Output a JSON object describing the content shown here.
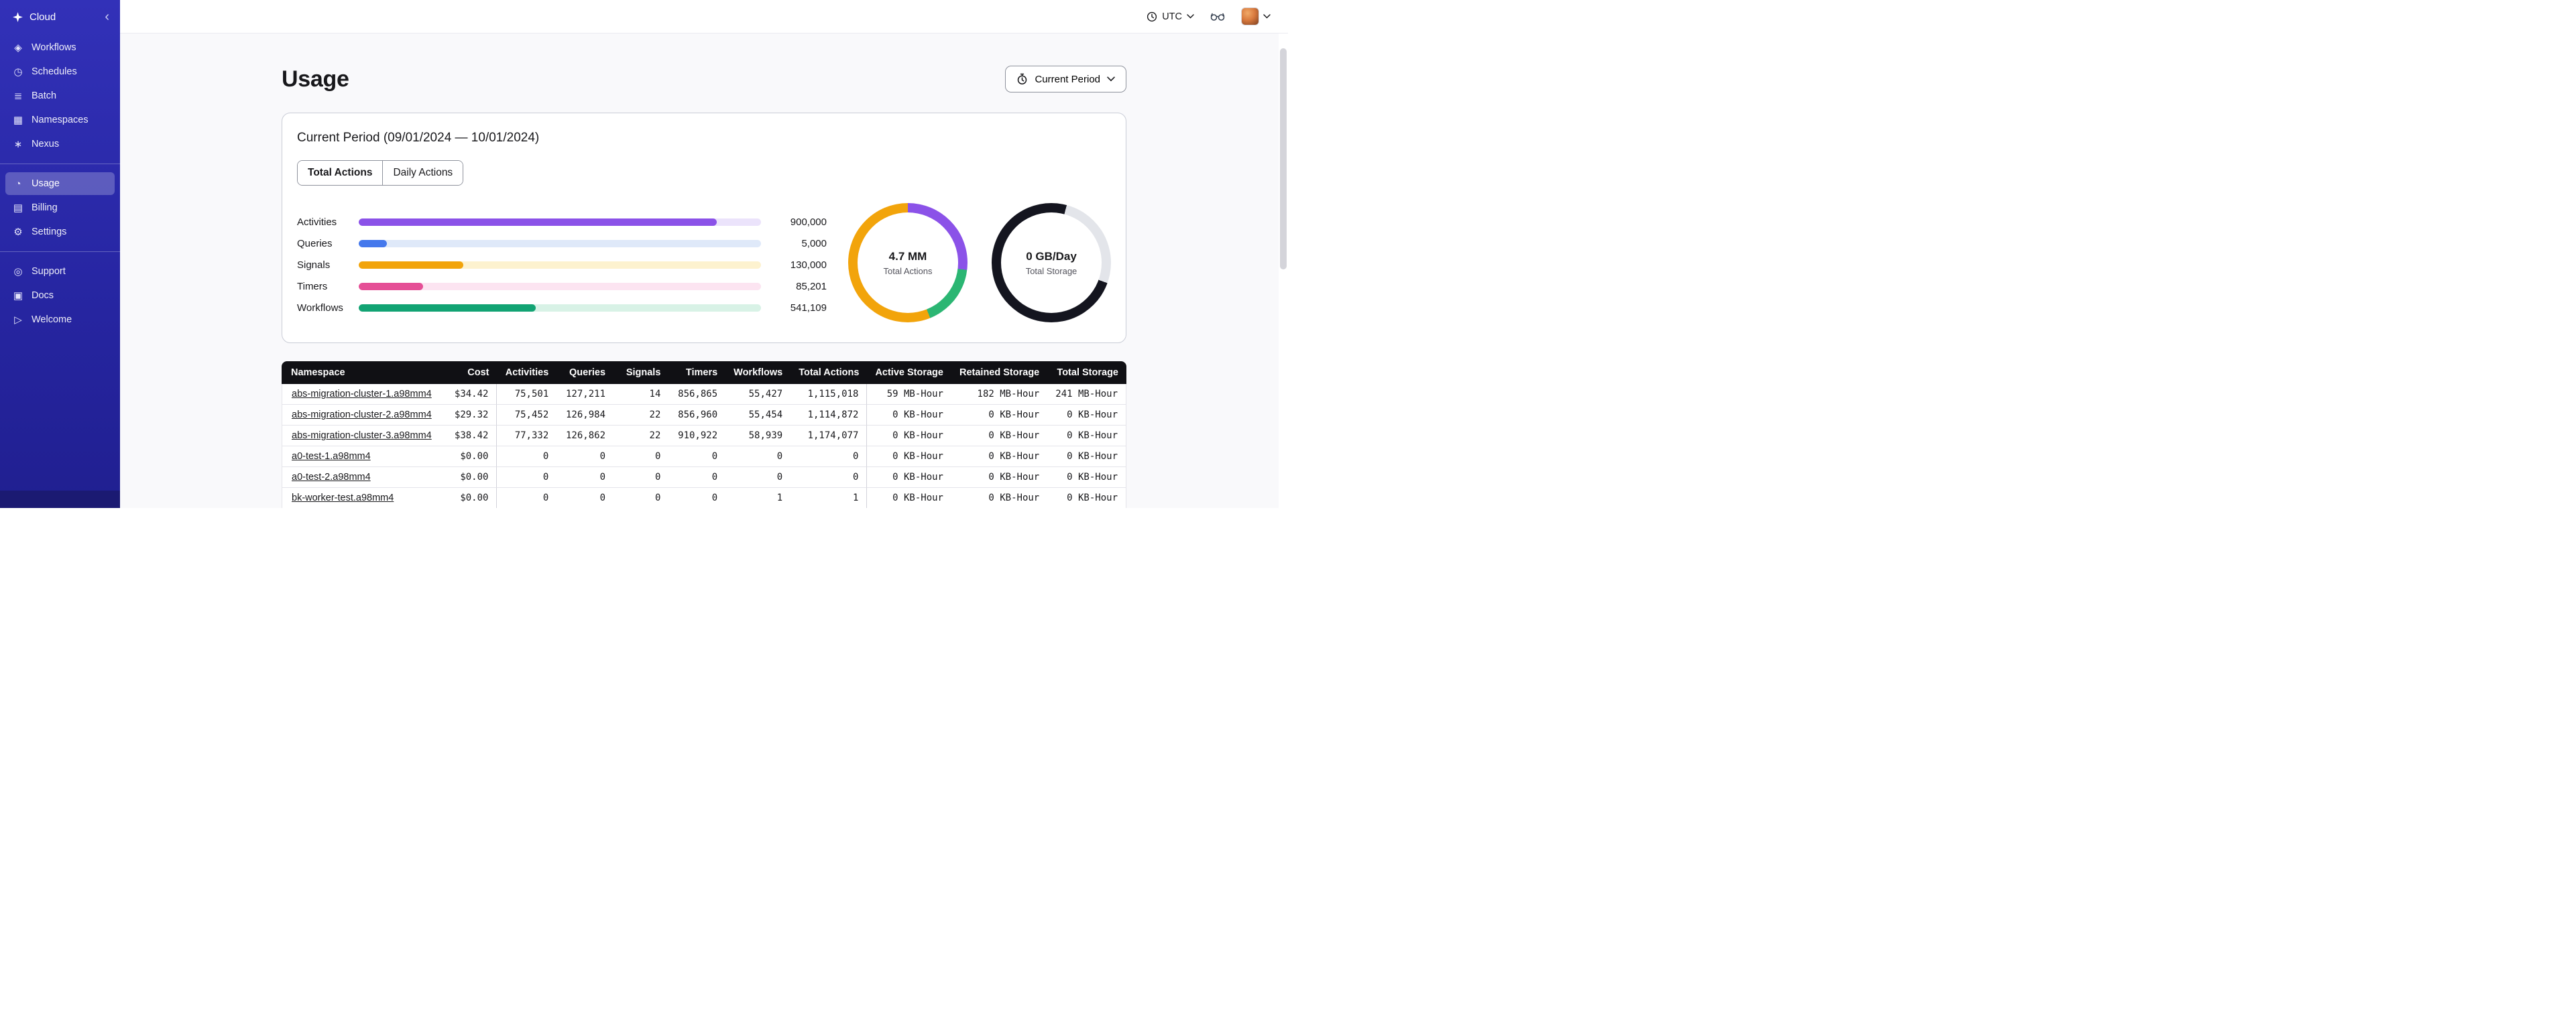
{
  "sidebar": {
    "brand": "Cloud",
    "collapse_icon": "‹",
    "groups": [
      {
        "items": [
          {
            "label": "Workflows",
            "icon": "workflows-icon",
            "glyph": "◈"
          },
          {
            "label": "Schedules",
            "icon": "schedules-icon",
            "glyph": "◷"
          },
          {
            "label": "Batch",
            "icon": "batch-icon",
            "glyph": "≣"
          },
          {
            "label": "Namespaces",
            "icon": "namespaces-icon",
            "glyph": "▦"
          },
          {
            "label": "Nexus",
            "icon": "nexus-icon",
            "glyph": "∗"
          }
        ]
      },
      {
        "items": [
          {
            "label": "Usage",
            "icon": "usage-icon",
            "glyph": "◔",
            "active": true
          },
          {
            "label": "Billing",
            "icon": "billing-icon",
            "glyph": "▤"
          },
          {
            "label": "Settings",
            "icon": "settings-icon",
            "glyph": "⚙"
          }
        ]
      },
      {
        "items": [
          {
            "label": "Support",
            "icon": "support-icon",
            "glyph": "◎"
          },
          {
            "label": "Docs",
            "icon": "docs-icon",
            "glyph": "▣"
          },
          {
            "label": "Welcome",
            "icon": "welcome-icon",
            "glyph": "▷"
          }
        ]
      }
    ]
  },
  "topbar": {
    "timezone": "UTC"
  },
  "page": {
    "title": "Usage",
    "period_button": {
      "label": "Current Period"
    },
    "card_title": "Current Period (09/01/2024 — 10/01/2024)",
    "tabs": [
      {
        "label": "Total Actions",
        "active": true
      },
      {
        "label": "Daily Actions",
        "active": false
      }
    ]
  },
  "chart_data": [
    {
      "type": "bar",
      "orientation": "horizontal",
      "title": "Current Period (09/01/2024 — 10/01/2024)",
      "categories": [
        "Activities",
        "Queries",
        "Signals",
        "Timers",
        "Workflows"
      ],
      "values": [
        900000,
        5000,
        130000,
        85201,
        541109
      ],
      "value_labels": [
        "900,000",
        "5,000",
        "130,000",
        "85,201",
        "541,109"
      ],
      "bar_pct": [
        89,
        7,
        26,
        16,
        44
      ],
      "bar_colors": [
        "#8b52e8",
        "#4478ec",
        "#f2a40b",
        "#e54f96",
        "#12a373"
      ],
      "track_colors": [
        "#ebe3fb",
        "#dfe9f9",
        "#fdf2cf",
        "#fce4f1",
        "#d8f2e6"
      ]
    },
    {
      "type": "pie",
      "subtype": "donut",
      "center_label": "4.7 MM",
      "center_sublabel": "Total Actions",
      "segments": [
        {
          "name": "purple",
          "color": "#8b52e8",
          "start": 0,
          "end": 97
        },
        {
          "name": "green",
          "color": "#2bb673",
          "start": 97,
          "end": 158
        },
        {
          "name": "orange",
          "color": "#f2a40b",
          "start": 158,
          "end": 360
        }
      ]
    },
    {
      "type": "pie",
      "subtype": "donut",
      "center_label": "0 GB/Day",
      "center_sublabel": "Total Storage",
      "segments": [
        {
          "name": "dark",
          "color": "#14151f",
          "start": 0,
          "end": 15
        },
        {
          "name": "light",
          "color": "#e3e5ea",
          "start": 15,
          "end": 110
        },
        {
          "name": "dark2",
          "color": "#14151f",
          "start": 110,
          "end": 360
        }
      ]
    }
  ],
  "table": {
    "columns": [
      "Namespace",
      "Cost",
      "Activities",
      "Queries",
      "Signals",
      "Timers",
      "Workflows",
      "Total Actions",
      "Active Storage",
      "Retained Storage",
      "Total Storage"
    ],
    "rows": [
      [
        "abs-migration-cluster-1.a98mm4",
        "$34.42",
        "75,501",
        "127,211",
        "14",
        "856,865",
        "55,427",
        "1,115,018",
        "59 MB-Hour",
        "182 MB-Hour",
        "241 MB-Hour"
      ],
      [
        "abs-migration-cluster-2.a98mm4",
        "$29.32",
        "75,452",
        "126,984",
        "22",
        "856,960",
        "55,454",
        "1,114,872",
        "0 KB-Hour",
        "0 KB-Hour",
        "0 KB-Hour"
      ],
      [
        "abs-migration-cluster-3.a98mm4",
        "$38.42",
        "77,332",
        "126,862",
        "22",
        "910,922",
        "58,939",
        "1,174,077",
        "0 KB-Hour",
        "0 KB-Hour",
        "0 KB-Hour"
      ],
      [
        "a0-test-1.a98mm4",
        "$0.00",
        "0",
        "0",
        "0",
        "0",
        "0",
        "0",
        "0 KB-Hour",
        "0 KB-Hour",
        "0 KB-Hour"
      ],
      [
        "a0-test-2.a98mm4",
        "$0.00",
        "0",
        "0",
        "0",
        "0",
        "0",
        "0",
        "0 KB-Hour",
        "0 KB-Hour",
        "0 KB-Hour"
      ],
      [
        "bk-worker-test.a98mm4",
        "$0.00",
        "0",
        "0",
        "0",
        "0",
        "1",
        "1",
        "0 KB-Hour",
        "0 KB-Hour",
        "0 KB-Hour"
      ]
    ]
  }
}
